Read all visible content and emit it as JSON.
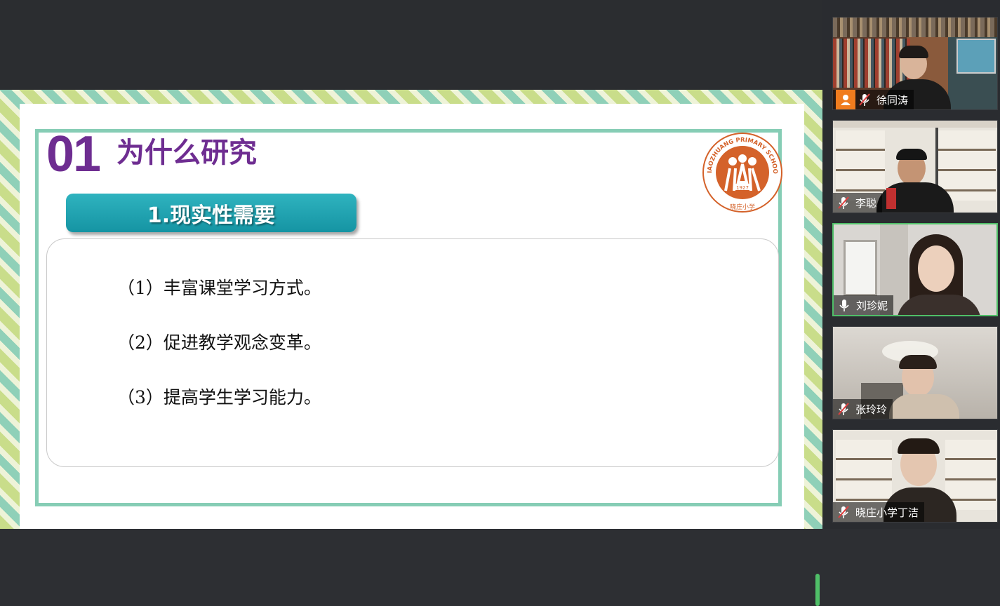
{
  "slide": {
    "number": "01",
    "heading": "为什么研究",
    "subtitle": "1.现实性需要",
    "items": [
      "（1）丰富课堂学习方式。",
      "（2）促进教学观念变革。",
      "（3）提高学生学习能力。"
    ],
    "logo": {
      "text_top": "XIAOZHUANG PRIMARY SCHOOL",
      "year": "1927",
      "text_bottom": "晓庄小学"
    }
  },
  "participants": [
    {
      "name": "徐同涛",
      "mic": "muted",
      "host_badge": true,
      "active": false
    },
    {
      "name": "李聪",
      "mic": "muted",
      "host_badge": false,
      "active": false
    },
    {
      "name": "刘珍妮",
      "mic": "on",
      "host_badge": false,
      "active": true
    },
    {
      "name": "张玲玲",
      "mic": "muted",
      "host_badge": false,
      "active": false
    },
    {
      "name": "晓庄小学丁洁",
      "mic": "muted",
      "host_badge": false,
      "active": false
    }
  ],
  "colors": {
    "heading": "#6e2d91",
    "subtitle_bg": "#1a9fad",
    "frame": "#86cdb5",
    "active_speaker": "#4fbf68",
    "host_badge": "#f07c1e"
  }
}
